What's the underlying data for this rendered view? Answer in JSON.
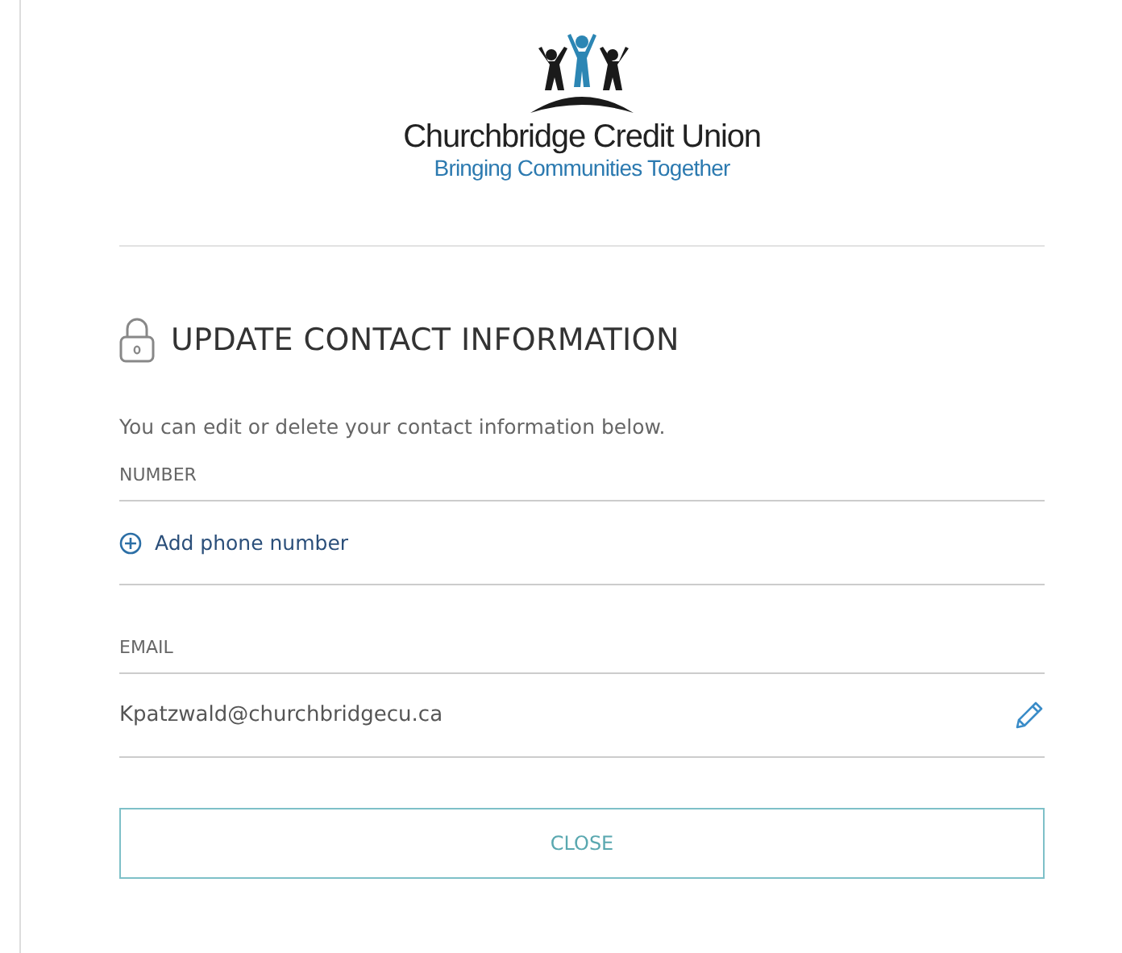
{
  "logo": {
    "name": "Churchbridge Credit Union",
    "tagline": "Bringing Communities Together"
  },
  "title": "UPDATE CONTACT INFORMATION",
  "intro": "You can edit or delete your contact information below.",
  "number": {
    "label": "NUMBER",
    "add_link": "Add phone number"
  },
  "email": {
    "label": "EMAIL",
    "value": "Kpatzwald@churchbridgecu.ca"
  },
  "buttons": [
    "CLOSE"
  ]
}
